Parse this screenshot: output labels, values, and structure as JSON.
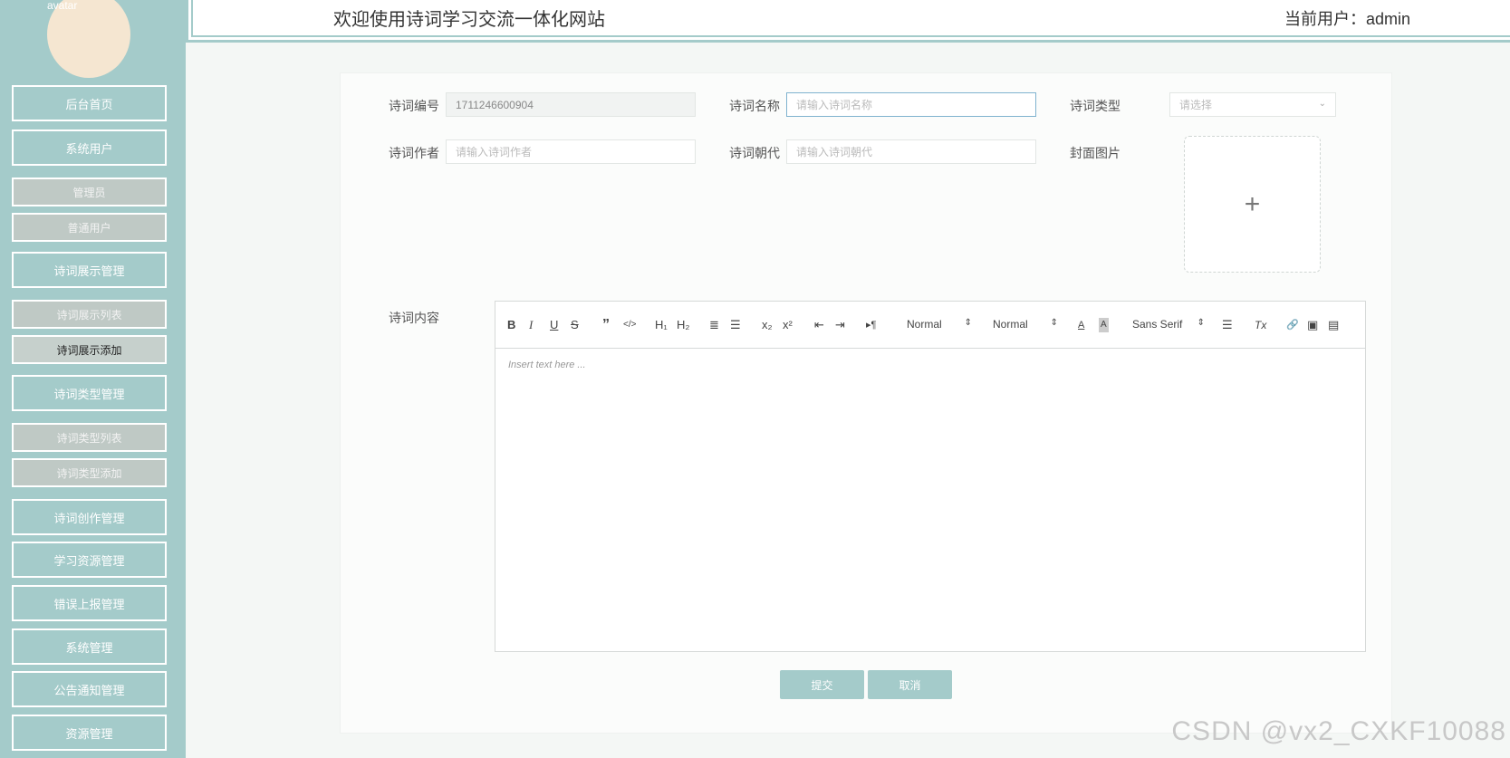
{
  "header": {
    "title": "欢迎使用诗词学习交流一体化网站",
    "current_user_label": "当前用户：",
    "current_user": "admin"
  },
  "sidebar": {
    "avatar_alt": "avatar",
    "items": [
      {
        "label": "后台首页",
        "type": "main"
      },
      {
        "label": "系统用户",
        "type": "main"
      },
      {
        "label": "管理员",
        "type": "sub"
      },
      {
        "label": "普通用户",
        "type": "sub"
      },
      {
        "label": "诗词展示管理",
        "type": "main"
      },
      {
        "label": "诗词展示列表",
        "type": "sub"
      },
      {
        "label": "诗词展示添加",
        "type": "sub",
        "active": true
      },
      {
        "label": "诗词类型管理",
        "type": "main"
      },
      {
        "label": "诗词类型列表",
        "type": "sub"
      },
      {
        "label": "诗词类型添加",
        "type": "sub"
      },
      {
        "label": "诗词创作管理",
        "type": "main"
      },
      {
        "label": "学习资源管理",
        "type": "main"
      },
      {
        "label": "错误上报管理",
        "type": "main"
      },
      {
        "label": "系统管理",
        "type": "main"
      },
      {
        "label": "公告通知管理",
        "type": "main"
      },
      {
        "label": "资源管理",
        "type": "main"
      }
    ]
  },
  "form": {
    "poem_id": {
      "label": "诗词编号",
      "value": "1711246600904"
    },
    "poem_name": {
      "label": "诗词名称",
      "placeholder": "请输入诗词名称"
    },
    "poem_type": {
      "label": "诗词类型",
      "placeholder": "请选择"
    },
    "poem_author": {
      "label": "诗词作者",
      "placeholder": "请输入诗词作者"
    },
    "poem_dynasty": {
      "label": "诗词朝代",
      "placeholder": "请输入诗词朝代"
    },
    "cover_image": {
      "label": "封面图片",
      "upload_symbol": "+"
    },
    "content": {
      "label": "诗词内容",
      "placeholder": "Insert text here ..."
    }
  },
  "editor_toolbar": {
    "bold": "B",
    "italic": "I",
    "underline": "U",
    "strike": "S",
    "blockquote": "”",
    "code": "</>",
    "h1": "H₁",
    "h2": "H₂",
    "ordered_list": "≣",
    "bullet_list": "☰",
    "subscript": "x₂",
    "superscript": "x²",
    "outdent": "⇤",
    "indent": "⇥",
    "direction": "▸¶",
    "size_select": "Normal",
    "header_select": "Normal",
    "color": "A",
    "background": "A",
    "font_select": "Sans Serif",
    "align": "☰",
    "clean": "Tx",
    "link": "🔗",
    "image": "▣",
    "video": "▤",
    "select_arrow": "⇕"
  },
  "buttons": {
    "submit": "提交",
    "cancel": "取消"
  },
  "watermark": "CSDN @vx2_CXKF10088"
}
